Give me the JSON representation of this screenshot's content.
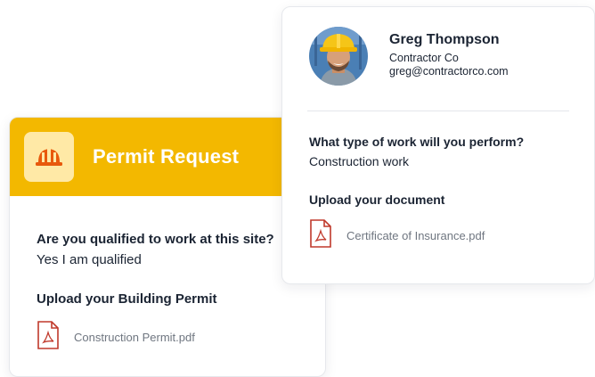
{
  "permit_card": {
    "title": "Permit Request",
    "question": "Are you qualified to work at this site?",
    "answer": "Yes I am qualified",
    "upload_label": "Upload your Building Permit",
    "file_name": "Construction Permit.pdf",
    "icon": "hard-hat-icon",
    "file_icon": "pdf-file-icon",
    "accent_color": "#f3b800"
  },
  "contractor_card": {
    "name": "Greg Thompson",
    "company": "Contractor Co",
    "email": "greg@contractorco.com",
    "question": "What type of work will you perform?",
    "answer": "Construction work",
    "upload_label": "Upload your document",
    "file_name": "Certificate of Insurance.pdf",
    "file_icon": "pdf-file-icon"
  },
  "colors": {
    "pdf_red": "#c0392b",
    "text_dark": "#1b2433",
    "text_muted": "#6f7680"
  }
}
